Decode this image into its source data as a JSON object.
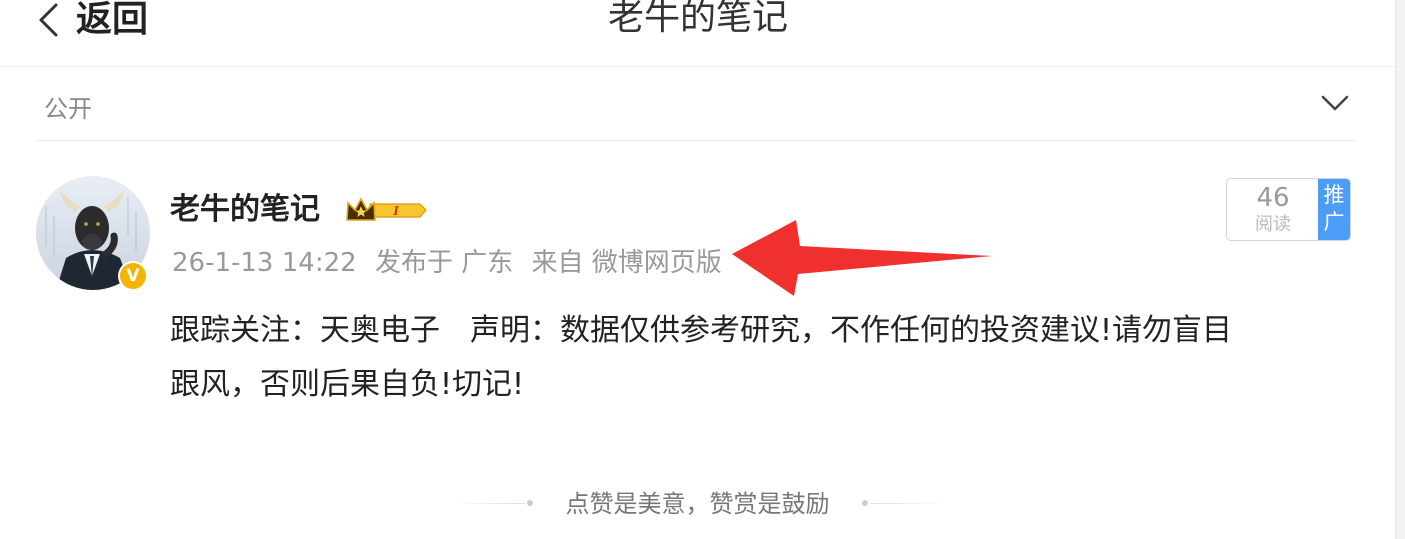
{
  "header": {
    "back_label": "返回",
    "title": "老牛的笔记"
  },
  "visibility": {
    "label": "公开"
  },
  "post": {
    "author": "老牛的笔记",
    "member_badge_text": "I",
    "verified_badge_text": "V",
    "time": "26-1-13 14:22",
    "location": "发布于 广东",
    "source": "来自 微博网页版",
    "read_count": "46",
    "read_label": "阅读",
    "promote_label_line1": "推",
    "promote_label_line2": "广",
    "text_line1": "跟踪关注：天奥电子　声明：数据仅供参考研究，不作任何的投资建议!请勿盲目",
    "text_line2": "跟风，否则后果自负!切记!"
  },
  "footer_tip": "点赞是美意，赞赏是鼓励",
  "colors": {
    "accent_blue": "#4c9df8",
    "verified_gold": "#f5b400",
    "annotation_red": "#f0302e"
  },
  "icons": {
    "back": "chevron-left-icon",
    "expand": "chevron-down-icon",
    "crown": "crown-member-icon",
    "verified": "verified-v-icon"
  }
}
